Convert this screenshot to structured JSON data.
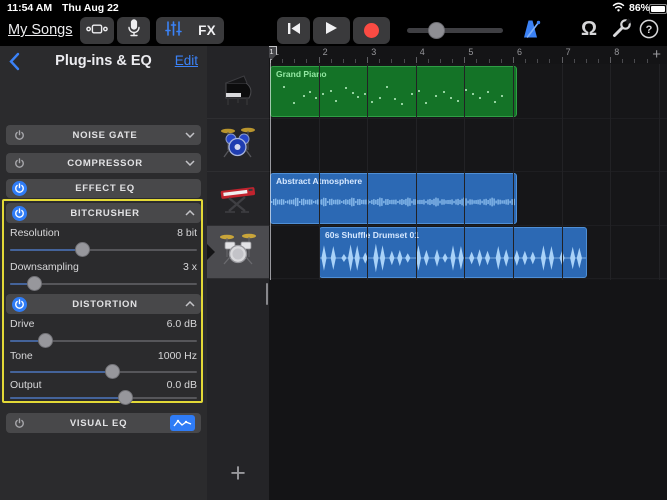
{
  "status_bar": {
    "time": "11:54 AM",
    "date": "Thu Aug 22",
    "battery_percent": "86%"
  },
  "toolbar": {
    "my_songs_label": "My Songs",
    "fx_label": "FX",
    "volume_slider_pos": 0.26,
    "accent_blue": "#3b82f6",
    "record_red": "#fb4b43"
  },
  "panel": {
    "title": "Plug-ins & EQ",
    "edit_label": "Edit",
    "highlight_color": "#e3d937",
    "plugins": [
      {
        "name": "NOISE GATE",
        "enabled": false
      },
      {
        "name": "COMPRESSOR",
        "enabled": false
      },
      {
        "name": "EFFECT EQ",
        "enabled": true
      },
      {
        "name": "BITCRUSHER",
        "enabled": true,
        "params": [
          {
            "label": "Resolution",
            "value": "8 bit",
            "slider_pos": 0.38
          },
          {
            "label": "Downsampling",
            "value": "3 x",
            "slider_pos": 0.1
          }
        ]
      },
      {
        "name": "DISTORTION",
        "enabled": true,
        "params": [
          {
            "label": "Drive",
            "value": "6.0 dB",
            "slider_pos": 0.16
          },
          {
            "label": "Tone",
            "value": "1000 Hz",
            "slider_pos": 0.55
          },
          {
            "label": "Output",
            "value": "0.0 dB",
            "slider_pos": 0.63
          }
        ]
      },
      {
        "name": "VISUAL EQ",
        "enabled": false
      }
    ]
  },
  "tracks": [
    {
      "instrument": "grand-piano",
      "selected": false
    },
    {
      "instrument": "drum-kit-electronic",
      "selected": false
    },
    {
      "instrument": "keyboard-synth",
      "selected": false
    },
    {
      "instrument": "drum-kit-acoustic",
      "selected": true
    }
  ],
  "add_track_label": "+",
  "timeline": {
    "bar_numbers": [
      "1",
      "2",
      "3",
      "4",
      "5",
      "6",
      "7",
      "8"
    ],
    "add_bars_label": "+",
    "playhead_bar": "1"
  },
  "regions": [
    {
      "label": "Grand Piano",
      "type": "midi",
      "color": "#147327",
      "track_index": 1,
      "start_bar": 1,
      "end_bar": 6.1,
      "notes": [
        [
          0.05,
          0.4
        ],
        [
          0.09,
          0.72
        ],
        [
          0.13,
          0.58
        ],
        [
          0.155,
          0.5
        ],
        [
          0.18,
          0.62
        ],
        [
          0.21,
          0.55
        ],
        [
          0.24,
          0.47
        ],
        [
          0.26,
          0.68
        ],
        [
          0.3,
          0.42
        ],
        [
          0.33,
          0.52
        ],
        [
          0.35,
          0.6
        ],
        [
          0.38,
          0.55
        ],
        [
          0.41,
          0.7
        ],
        [
          0.44,
          0.62
        ],
        [
          0.47,
          0.4
        ],
        [
          0.5,
          0.65
        ],
        [
          0.53,
          0.75
        ],
        [
          0.57,
          0.55
        ],
        [
          0.6,
          0.47
        ],
        [
          0.63,
          0.72
        ],
        [
          0.67,
          0.58
        ],
        [
          0.7,
          0.5
        ],
        [
          0.73,
          0.62
        ],
        [
          0.76,
          0.68
        ],
        [
          0.79,
          0.45
        ],
        [
          0.82,
          0.55
        ],
        [
          0.85,
          0.62
        ],
        [
          0.88,
          0.5
        ],
        [
          0.91,
          0.7
        ],
        [
          0.94,
          0.58
        ]
      ]
    },
    {
      "label": "Abstract Atmosphere",
      "type": "audio",
      "color": "#2c69b4",
      "track_index": 3,
      "start_bar": 1,
      "end_bar": 6.1
    },
    {
      "label": "60s Shuffle Drumset 01",
      "type": "audio",
      "color": "#2c69b4",
      "track_index": 4,
      "start_bar": 2.05,
      "end_bar": 7.55,
      "hits": [
        [
          0.015,
          0.8
        ],
        [
          0.05,
          0.75
        ],
        [
          0.09,
          0.25
        ],
        [
          0.115,
          0.85
        ],
        [
          0.14,
          0.8
        ],
        [
          0.17,
          0.35
        ],
        [
          0.21,
          0.9
        ],
        [
          0.235,
          0.8
        ],
        [
          0.27,
          0.45
        ],
        [
          0.3,
          0.5
        ],
        [
          0.33,
          0.3
        ],
        [
          0.37,
          0.8
        ],
        [
          0.4,
          0.5
        ],
        [
          0.44,
          0.55
        ],
        [
          0.47,
          0.3
        ],
        [
          0.5,
          0.8
        ],
        [
          0.53,
          0.75
        ],
        [
          0.57,
          0.4
        ],
        [
          0.6,
          0.55
        ],
        [
          0.63,
          0.45
        ],
        [
          0.67,
          0.75
        ],
        [
          0.7,
          0.55
        ],
        [
          0.74,
          0.5
        ],
        [
          0.77,
          0.45
        ],
        [
          0.8,
          0.4
        ],
        [
          0.84,
          0.8
        ],
        [
          0.87,
          0.75
        ],
        [
          0.91,
          0.45
        ],
        [
          0.95,
          0.7
        ],
        [
          0.975,
          0.65
        ]
      ]
    }
  ]
}
